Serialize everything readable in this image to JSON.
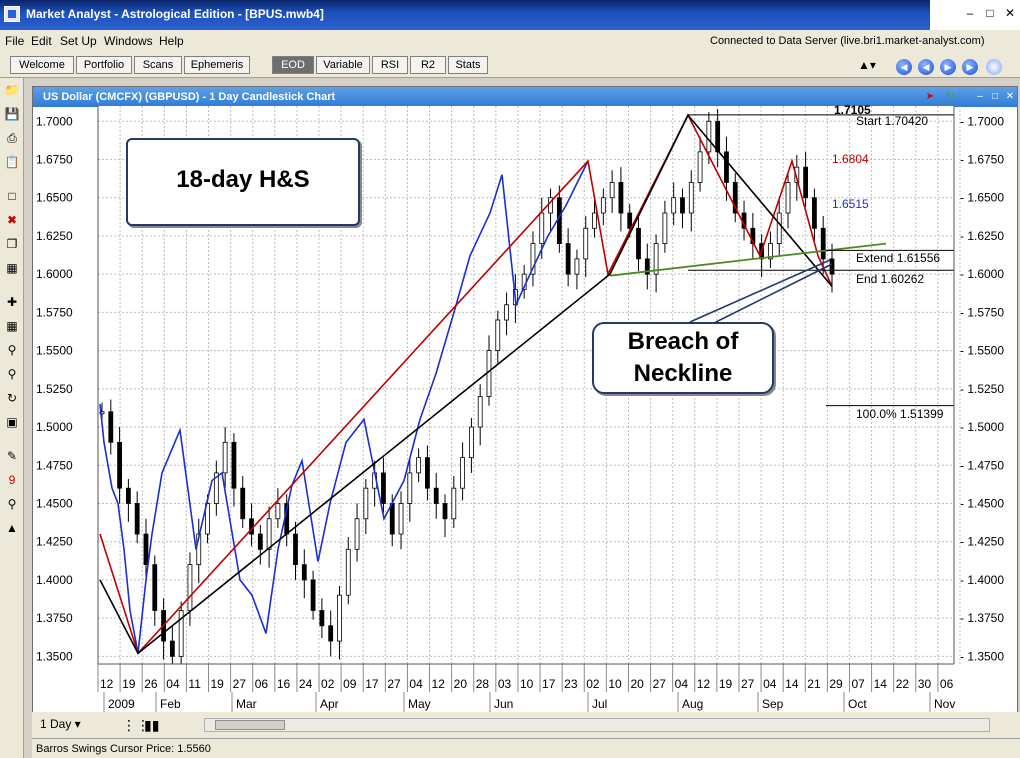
{
  "window": {
    "title": "Market Analyst - Astrological Edition - [BPUS.mwb4]"
  },
  "menu": [
    "File",
    "Edit",
    "Set Up",
    "Windows",
    "Help"
  ],
  "connection": "Connected to Data Server (live.bri1.market-analyst.com)",
  "tabs": {
    "left": [
      "Welcome",
      "Portfolio",
      "Scans",
      "Ephemeris"
    ],
    "right": [
      "EOD",
      "Variable",
      "RSI",
      "R2",
      "Stats"
    ]
  },
  "chart_window": {
    "title": "US Dollar (CMCFX) (GBPUSD) - 1 Day Candlestick Chart"
  },
  "annotations": {
    "hs_label": "18-day H&S",
    "breach_line1": "Breach of",
    "breach_line2": "Neckline",
    "start_label": "Start 1.70420",
    "top_label": "1.7105",
    "red_level": "1.6804",
    "blue_level": "1.6515",
    "extend_label": "Extend 1.61556",
    "end_label": "End 1.60262",
    "pct_label": "100.0% 1.51399"
  },
  "colors": {
    "red": "#c00000",
    "blue": "#1a2fd0",
    "green": "#4a8a1e",
    "callout_border": "#1f3a6b"
  },
  "chart_data": {
    "type": "candlestick",
    "yticks": [
      "1.7000",
      "1.6750",
      "1.6500",
      "1.6250",
      "1.6000",
      "1.5750",
      "1.5500",
      "1.5250",
      "1.5000",
      "1.4750",
      "1.4500",
      "1.4250",
      "1.4000",
      "1.3750",
      "1.3500"
    ],
    "ylim": [
      1.345,
      1.71
    ],
    "xticks": [
      "12",
      "19",
      "26",
      "04",
      "11",
      "19",
      "27",
      "06",
      "16",
      "24",
      "02",
      "09",
      "17",
      "27",
      "04",
      "12",
      "20",
      "28",
      "03",
      "10",
      "17",
      "23",
      "02",
      "10",
      "20",
      "27",
      "04",
      "12",
      "19",
      "27",
      "04",
      "14",
      "21",
      "29",
      "07",
      "14",
      "22",
      "30",
      "06"
    ],
    "months": [
      "2009",
      "Feb",
      "Mar",
      "Apr",
      "May",
      "Jun",
      "Jul",
      "Aug",
      "Sep",
      "Oct",
      "Nov"
    ],
    "closes": [
      1.51,
      1.49,
      1.46,
      1.45,
      1.43,
      1.41,
      1.38,
      1.36,
      1.35,
      1.38,
      1.41,
      1.43,
      1.45,
      1.47,
      1.49,
      1.46,
      1.44,
      1.43,
      1.42,
      1.44,
      1.45,
      1.43,
      1.41,
      1.4,
      1.38,
      1.37,
      1.36,
      1.39,
      1.42,
      1.44,
      1.46,
      1.47,
      1.45,
      1.43,
      1.45,
      1.47,
      1.48,
      1.46,
      1.45,
      1.44,
      1.46,
      1.48,
      1.5,
      1.52,
      1.55,
      1.57,
      1.58,
      1.59,
      1.6,
      1.62,
      1.64,
      1.65,
      1.62,
      1.6,
      1.61,
      1.63,
      1.64,
      1.65,
      1.66,
      1.64,
      1.63,
      1.61,
      1.6,
      1.62,
      1.64,
      1.65,
      1.64,
      1.66,
      1.68,
      1.7,
      1.68,
      1.66,
      1.64,
      1.63,
      1.62,
      1.61,
      1.62,
      1.64,
      1.66,
      1.67,
      1.65,
      1.63,
      1.61,
      1.6
    ]
  }
}
